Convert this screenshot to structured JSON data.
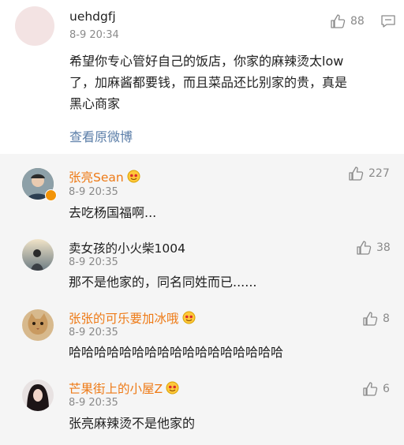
{
  "main_comment": {
    "username": "uehdgfj",
    "time": "8-9 20:34",
    "likes": "88",
    "text_lines": [
      "希望你专心管好自己的饭店，你家的麻辣烫太low",
      "了，加麻酱都要钱，而且菜品还比别家的贵，真是",
      "黑心商家"
    ],
    "view_original": "查看原微博"
  },
  "replies": [
    {
      "username": "张亮Sean",
      "time": "8-9 20:35",
      "likes": "227",
      "text": "去吃杨国福啊..."
    },
    {
      "username": "卖女孩的小火柴1004",
      "time": "8-9 20:35",
      "likes": "38",
      "text": "那不是他家的，同名同姓而已......"
    },
    {
      "username": "张张的可乐要加冰哦",
      "time": "8-9 20:35",
      "likes": "8",
      "text": "哈哈哈哈哈哈哈哈哈哈哈哈哈哈哈哈哈"
    },
    {
      "username": "芒果街上的小屋Z",
      "time": "8-9 20:35",
      "likes": "6",
      "text": "张亮麻辣烫不是他家的"
    }
  ],
  "colors": {
    "orange_name": "#ee7a16",
    "link": "#5b7ea8",
    "muted": "#8a8a8a",
    "reply_bg": "#f5f5f5"
  }
}
